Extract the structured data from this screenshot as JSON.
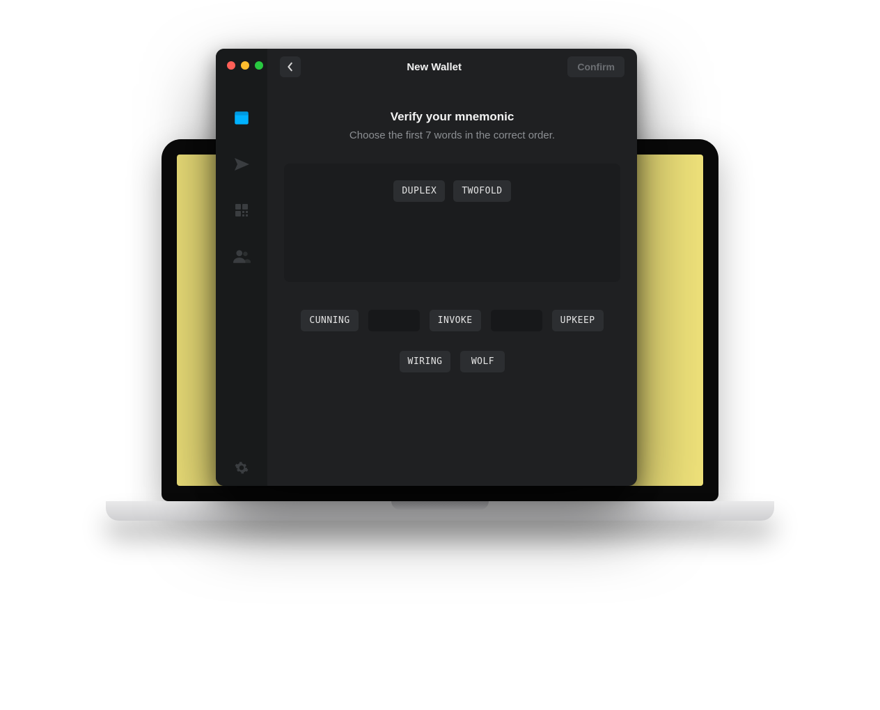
{
  "background": {
    "screen_color": "#efe27a"
  },
  "window": {
    "title": "New Wallet",
    "confirm_label": "Confirm"
  },
  "sidebar": {
    "items": [
      {
        "icon": "wallet-icon",
        "active": true
      },
      {
        "icon": "send-icon",
        "active": false
      },
      {
        "icon": "qr-icon",
        "active": false
      },
      {
        "icon": "contacts-icon",
        "active": false
      }
    ],
    "footer_icon": "gear-icon"
  },
  "verify": {
    "heading": "Verify your mnemonic",
    "subheading": "Choose the first 7 words in the correct order."
  },
  "selected_words": [
    "DUPLEX",
    "TWOFOLD"
  ],
  "pool_row1": [
    "CUNNING",
    "",
    "INVOKE",
    "",
    "UPKEEP"
  ],
  "pool_row2": [
    "WIRING",
    "WOLF"
  ]
}
